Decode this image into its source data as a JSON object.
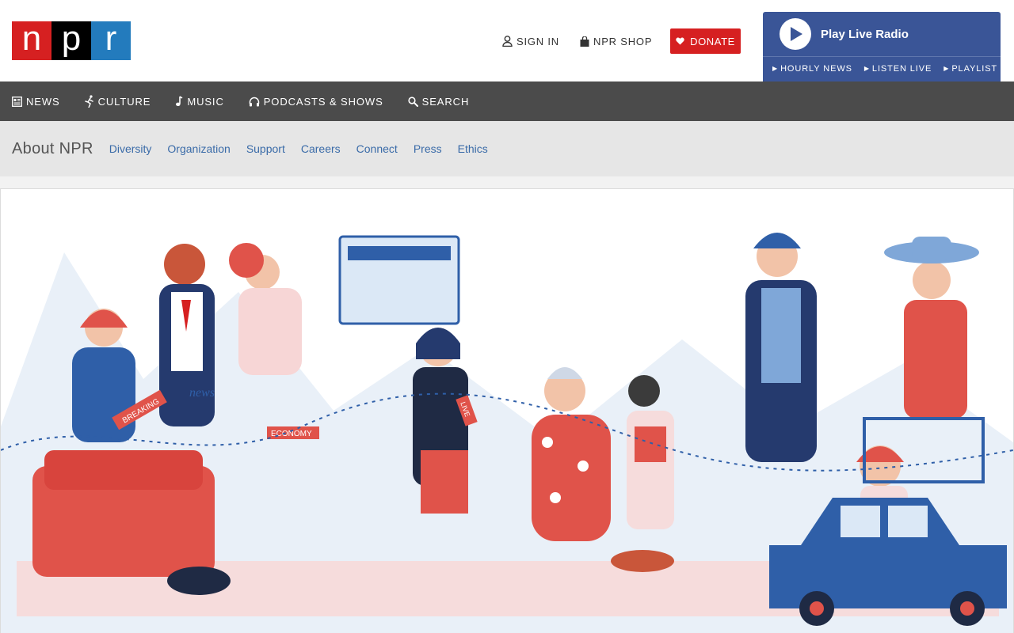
{
  "logo": {
    "letters": [
      "n",
      "p",
      "r"
    ],
    "colors": [
      "#d62021",
      "#000000",
      "#237bbd"
    ]
  },
  "header": {
    "sign_in": "SIGN IN",
    "shop": "NPR SHOP",
    "donate": "DONATE"
  },
  "radio": {
    "title": "Play Live Radio",
    "links": [
      "HOURLY NEWS",
      "LISTEN LIVE",
      "PLAYLIST"
    ]
  },
  "nav": {
    "items": [
      {
        "label": "NEWS",
        "icon": "newspaper-icon"
      },
      {
        "label": "CULTURE",
        "icon": "culture-icon"
      },
      {
        "label": "MUSIC",
        "icon": "music-note-icon"
      },
      {
        "label": "PODCASTS & SHOWS",
        "icon": "headphones-icon"
      },
      {
        "label": "SEARCH",
        "icon": "search-icon"
      }
    ]
  },
  "subnav": {
    "section": "About NPR",
    "links": [
      "Diversity",
      "Organization",
      "Support",
      "Careers",
      "Connect",
      "Press",
      "Ethics"
    ]
  },
  "hero": {
    "labels": [
      "BREAKING",
      "ECONOMY",
      "LIVE",
      "news"
    ]
  },
  "colors": {
    "red": "#d62021",
    "blue": "#237bbd",
    "radio_blue": "#3a5597",
    "nav_gray": "#4b4b4b",
    "subnav_gray": "#e6e6e6",
    "link_blue": "#3a6ba8"
  }
}
